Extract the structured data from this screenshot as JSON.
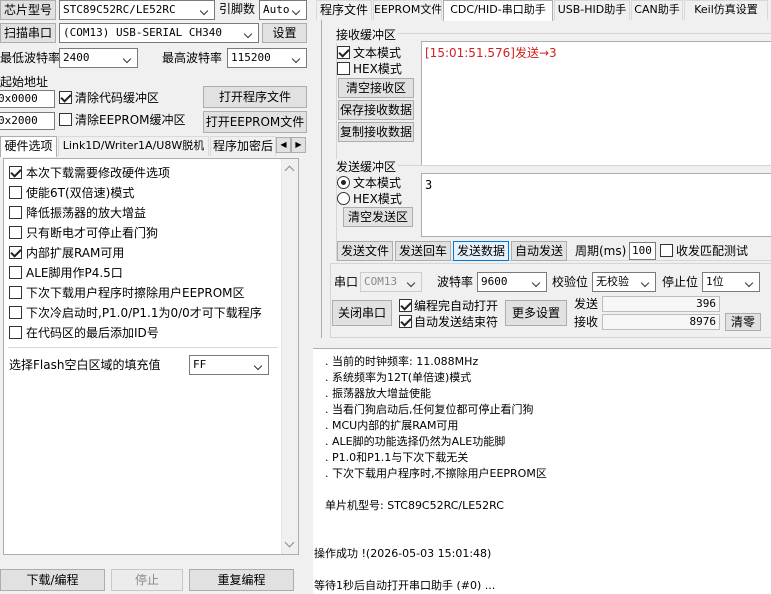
{
  "left": {
    "chip_label": "芯片型号",
    "chip_value": "STC89C52RC/LE52RC",
    "pin_label": "引脚数",
    "pin_value": "Auto",
    "scan_button": "扫描串口",
    "port_value": "(COM13) USB-SERIAL CH340",
    "settings_button": "设置",
    "min_baud_label": "最低波特率",
    "min_baud_value": "2400",
    "max_baud_label": "最高波特率",
    "max_baud_value": "115200",
    "start_addr_label": "起始地址",
    "addr1": "0x0000",
    "clear_code_label": "清除代码缓冲区",
    "open_program_button": "打开程序文件",
    "addr2": "0x2000",
    "clear_eeprom_label": "清除EEPROM缓冲区",
    "open_eeprom_button": "打开EEPROM文件",
    "tabs": [
      "硬件选项",
      "Link1D/Writer1A/U8W脱机",
      "程序加密后"
    ],
    "options": [
      {
        "label": "本次下载需要修改硬件选项",
        "checked": true
      },
      {
        "label": "使能6T(双倍速)模式",
        "checked": false
      },
      {
        "label": "降低振荡器的放大增益",
        "checked": false
      },
      {
        "label": "只有断电才可停止看门狗",
        "checked": false
      },
      {
        "label": "内部扩展RAM可用",
        "checked": true
      },
      {
        "label": "ALE脚用作P4.5口",
        "checked": false
      },
      {
        "label": "下次下载用户程序时擦除用户EEPROM区",
        "checked": false
      },
      {
        "label": "下次冷启动时,P1.0/P1.1为0/0才可下载程序",
        "checked": false
      },
      {
        "label": "在代码区的最后添加ID号",
        "checked": false
      }
    ],
    "flash_fill_label": "选择Flash空白区域的填充值",
    "flash_fill_value": "FF",
    "download_button": "下载/编程",
    "stop_button": "停止",
    "repeat_button": "重复编程"
  },
  "right": {
    "tabs": [
      "程序文件",
      "EEPROM文件",
      "CDC/HID-串口助手",
      "USB-HID助手",
      "CAN助手",
      "Keil仿真设置"
    ],
    "receive": {
      "group_label": "接收缓冲区",
      "text_mode": "文本模式",
      "hex_mode": "HEX模式",
      "clear_button": "清空接收区",
      "save_button": "保存接收数据",
      "copy_button": "复制接收数据",
      "content": "[15:01:51.576]发送→3"
    },
    "send": {
      "group_label": "发送缓冲区",
      "text_mode": "文本模式",
      "hex_mode": "HEX模式",
      "clear_button": "清空发送区",
      "content": "3",
      "send_file_button": "发送文件",
      "send_enter_button": "发送回车",
      "send_data_button": "发送数据",
      "auto_send_button": "自动发送",
      "period_label": "周期(ms)",
      "period_value": "100",
      "match_label": "收发匹配测试"
    },
    "serial": {
      "port_label": "串口",
      "port_value": "COM13",
      "baud_label": "波特率",
      "baud_value": "9600",
      "parity_label": "校验位",
      "parity_value": "无校验",
      "stop_label": "停止位",
      "stop_value": "1位",
      "close_button": "关闭串口",
      "auto_open_label": "编程完自动打开",
      "auto_send_end_label": "自动发送结束符",
      "more_button": "更多设置",
      "send_label": "发送",
      "send_count": "396",
      "recv_label": "接收",
      "recv_count": "8976",
      "clear_button": "清零"
    },
    "log": {
      "lines": [
        ". 当前的时钟频率: 11.088MHz",
        ". 系统频率为12T(单倍速)模式",
        ". 振荡器放大增益使能",
        ". 当看门狗启动后,任何复位都可停止看门狗",
        ". MCU内部的扩展RAM可用",
        ". ALE脚的功能选择仍然为ALE功能脚",
        ". P1.0和P1.1与下次下载无关",
        ". 下次下载用户程序时,不擦除用户EEPROM区"
      ],
      "chip_line": "单片机型号: STC89C52RC/LE52RC",
      "success_line": "操作成功 !(2026-05-03 15:01:48)",
      "wait_line": "等待1秒后自动打开串口助手 (#0) ..."
    }
  }
}
